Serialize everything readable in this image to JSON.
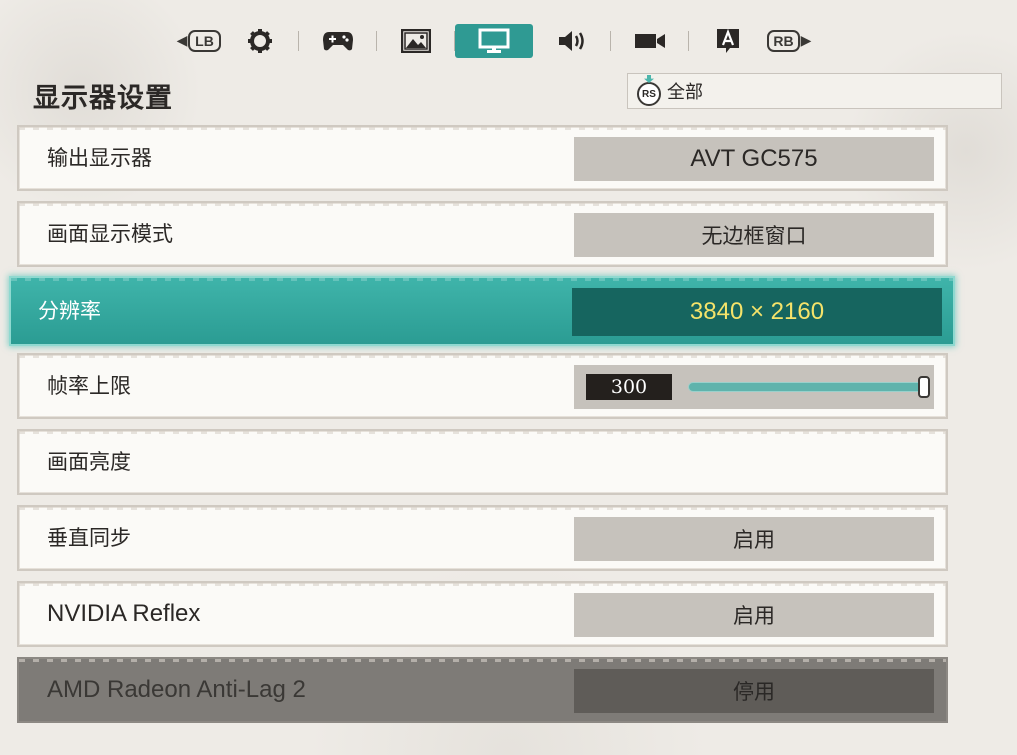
{
  "tabs": {
    "left_bumper": "LB",
    "right_bumper": "RB",
    "items": [
      {
        "icon": "gear-icon"
      },
      {
        "icon": "gamepad-icon"
      },
      {
        "icon": "image-icon"
      },
      {
        "icon": "monitor-icon",
        "active": true
      },
      {
        "icon": "speaker-icon"
      },
      {
        "icon": "camera-icon"
      },
      {
        "icon": "text-a-icon"
      }
    ]
  },
  "page": {
    "title": "显示器设置",
    "filter_button": "RS",
    "filter_label": "全部"
  },
  "settings": [
    {
      "label": "输出显示器",
      "value": "AVT GC575"
    },
    {
      "label": "画面显示模式",
      "value": "无边框窗口"
    },
    {
      "label": "分辨率",
      "value": "3840 × 2160",
      "selected": true
    },
    {
      "label": "帧率上限",
      "slider_value": "300",
      "slider_fraction": 1.0
    },
    {
      "label": "画面亮度"
    },
    {
      "label": "垂直同步",
      "value": "启用"
    },
    {
      "label": "NVIDIA Reflex",
      "value": "启用"
    },
    {
      "label": "AMD Radeon Anti-Lag 2",
      "value": "停用",
      "disabled": true
    }
  ],
  "colors": {
    "accent_teal": "#2f9a93",
    "selected_value_bg": "#16655f",
    "selected_value_text": "#f5e36a",
    "value_box_bg": "#c6c2bc"
  }
}
